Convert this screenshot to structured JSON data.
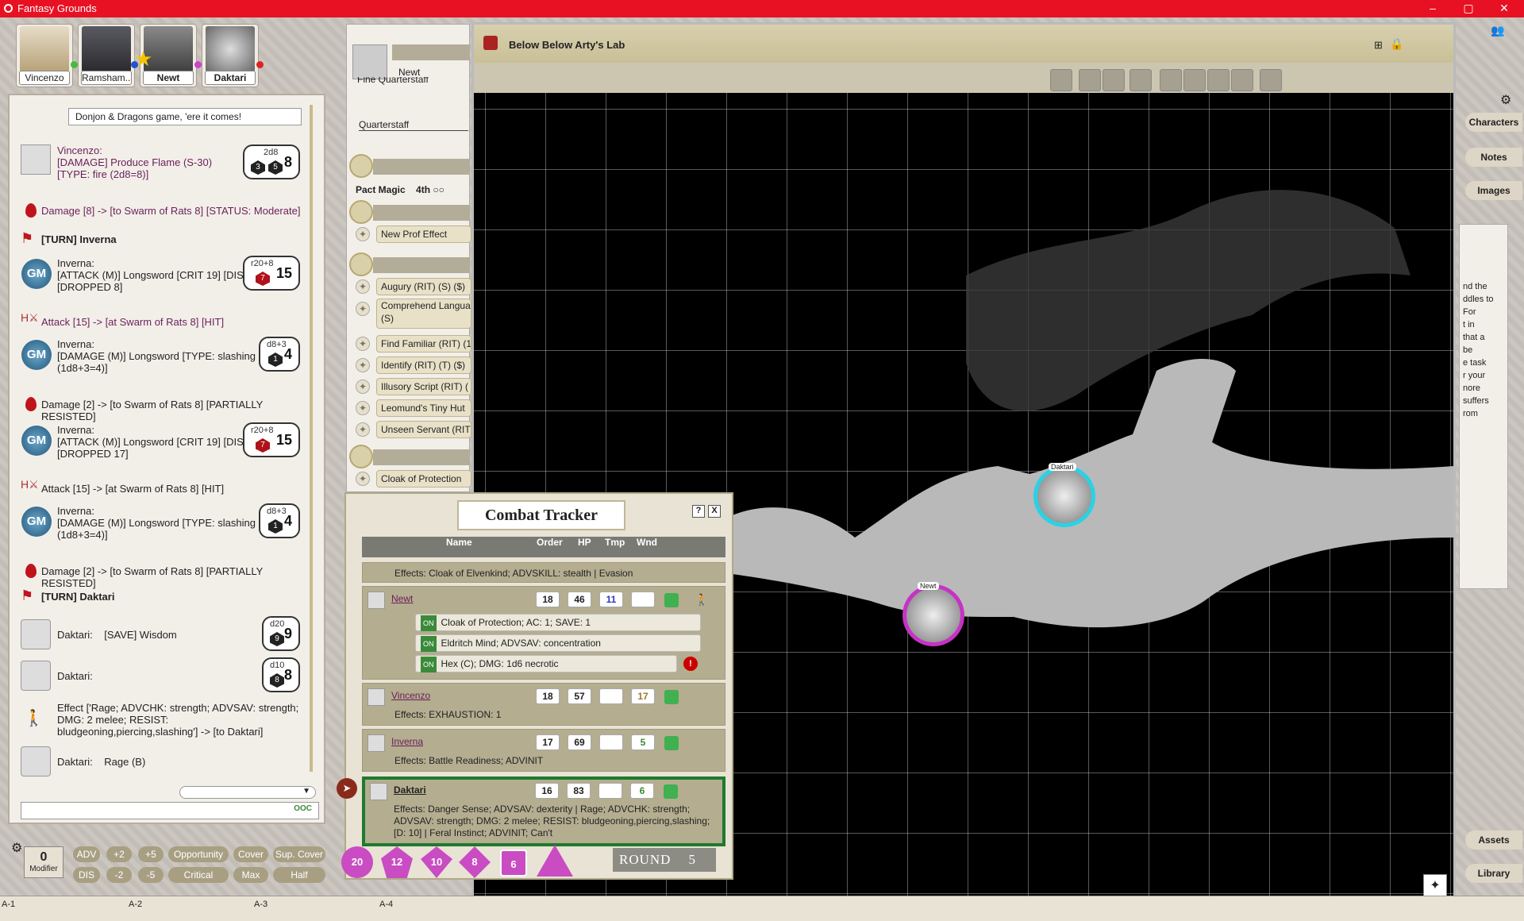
{
  "window": {
    "title": "Fantasy Grounds",
    "minimize": "–",
    "maximize": "▢",
    "close": "✕"
  },
  "party": [
    {
      "name": "Vincenzo",
      "dot": "#44bb44"
    },
    {
      "name": "Ramsham...",
      "dot": "#2255cc"
    },
    {
      "name": "Newt",
      "dot": "#cc44cc"
    },
    {
      "name": "Daktari",
      "dot": "#dd2222"
    }
  ],
  "chat": {
    "top_text": "Donjon & Dragons game, 'ere it comes!",
    "messages": [
      {
        "who": "Vincenzo:",
        "lines": [
          "[DAMAGE] Produce Flame (S-30)",
          "[TYPE: fire (2d8=8)]"
        ],
        "formula": "2d8",
        "dice": [
          "3",
          "5"
        ],
        "total": "8"
      },
      {
        "line": "Damage [8] -> [to Swarm of Rats 8] [STATUS: Moderate]"
      },
      {
        "line": "[TURN] Inverna"
      },
      {
        "who": "Inverna:",
        "lines": [
          "[ATTACK (M)] Longsword [CRIT 19] [DIS]",
          "[DROPPED 8]"
        ],
        "formula": "r20+8",
        "dice": [
          "7"
        ],
        "total": "15"
      },
      {
        "line": "Attack [15] -> [at Swarm of Rats 8] [HIT]"
      },
      {
        "who": "Inverna:",
        "lines": [
          "[DAMAGE (M)] Longsword [TYPE: slashing",
          "(1d8+3=4)]"
        ],
        "formula": "d8+3",
        "dice": [
          "1"
        ],
        "total": "4"
      },
      {
        "line": "Damage [2] -> [to Swarm of Rats 8] [PARTIALLY RESISTED]"
      },
      {
        "who": "Inverna:",
        "lines": [
          "[ATTACK (M)] Longsword [CRIT 19] [DIS]",
          "[DROPPED 17]"
        ],
        "formula": "r20+8",
        "dice": [
          "7"
        ],
        "total": "15"
      },
      {
        "line": "Attack [15] -> [at Swarm of Rats 8] [HIT]"
      },
      {
        "who": "Inverna:",
        "lines": [
          "[DAMAGE (M)] Longsword [TYPE: slashing",
          "(1d8+3=4)]"
        ],
        "formula": "d8+3",
        "dice": [
          "1"
        ],
        "total": "4"
      },
      {
        "line": "Damage [2] -> [to Swarm of Rats 8] [PARTIALLY RESISTED]"
      },
      {
        "line": "[TURN] Daktari"
      },
      {
        "who": "Daktari:",
        "lines": [
          "[SAVE] Wisdom"
        ],
        "formula": "d20",
        "dice": [
          "9"
        ],
        "total": "9"
      },
      {
        "who": "Daktari:",
        "lines": [
          ""
        ],
        "formula": "d10",
        "dice": [
          "8"
        ],
        "total": "8"
      },
      {
        "line": "Effect ['Rage; ADVCHK: strength; ADVSAV: strength; DMG: 2 melee; RESIST: bludgeoning,piercing,slashing'] -> [to Daktari]"
      },
      {
        "who": "Daktari:",
        "lines": [
          "Rage (B)"
        ]
      }
    ],
    "ooc": "OOC"
  },
  "modifier": {
    "value": "0",
    "label": "Modifier"
  },
  "mod_buttons": [
    "ADV",
    "+2",
    "+5",
    "Opportunity",
    "Cover",
    "Sup. Cover",
    "DIS",
    "-2",
    "-5",
    "Critical",
    "Max",
    "Half"
  ],
  "charsheet": {
    "name": "Newt",
    "weapon_top": "Fine Quarterstaff",
    "weapon": "Quarterstaff",
    "pact": "Pact Magic",
    "pact_level": "4th",
    "pact_slots": "○○",
    "spells_a": [
      "New Prof Effect"
    ],
    "spells_b": [
      "Augury (RIT) (S) ($)",
      "Comprehend Langua (S)",
      "Find Familiar (RIT) (1",
      "Identify (RIT) (T) ($)",
      "Illusory Script (RIT) (",
      "Leomund's Tiny Hut",
      "Unseen Servant (RIT"
    ],
    "spells_c": [
      "Cloak of Protection"
    ]
  },
  "map": {
    "title": "Below Below Arty's Lab",
    "tokens": [
      {
        "name": "Daktari"
      },
      {
        "name": "Newt"
      }
    ]
  },
  "sidebar": [
    "Characters",
    "Notes",
    "Images",
    "Assets",
    "Library"
  ],
  "note_text": [
    "nd the",
    "ddles to",
    "For",
    "t in",
    "that a",
    "",
    "be",
    "e task",
    "r your",
    "",
    "nore",
    "suffers",
    "",
    "rom"
  ],
  "combat": {
    "title": "Combat Tracker",
    "help": "?",
    "close": "X",
    "columns": [
      "Name",
      "Order",
      "HP",
      "Tmp",
      "Wnd"
    ],
    "top_effects": "Effects: Cloak of Elvenkind; ADVSKILL: stealth | Evasion",
    "rows": [
      {
        "name": "Newt",
        "order": "18",
        "hp": "46",
        "tmp": "11",
        "wnd": "",
        "effects": [
          "Cloak of Protection; AC: 1; SAVE: 1",
          "Eldritch Mind; ADVSAV: concentration",
          "Hex (C); DMG: 1d6 necrotic"
        ]
      },
      {
        "name": "Vincenzo",
        "order": "18",
        "hp": "57",
        "tmp": "",
        "wnd": "17",
        "effect_line": "Effects: EXHAUSTION: 1"
      },
      {
        "name": "Inverna",
        "order": "17",
        "hp": "69",
        "tmp": "",
        "wnd": "5",
        "effect_line": "Effects: Battle Readiness; ADVINIT"
      },
      {
        "name": "Daktari",
        "order": "16",
        "hp": "83",
        "tmp": "",
        "wnd": "6",
        "effect_line": "Effects: Danger Sense; ADVSAV: dexterity | Rage; ADVCHK: strength; ADVSAV: strength; DMG: 2 melee; RESIST: bludgeoning,piercing,slashing; [D: 10] | Feral Instinct; ADVINIT; Can't"
      }
    ],
    "on_label": "ON",
    "round_label": "ROUND",
    "round": "5",
    "dice": [
      "20",
      "12",
      "10",
      "8",
      "6"
    ]
  },
  "bottom_tabs": [
    "A-1",
    "A-2",
    "A-3",
    "A-4"
  ]
}
